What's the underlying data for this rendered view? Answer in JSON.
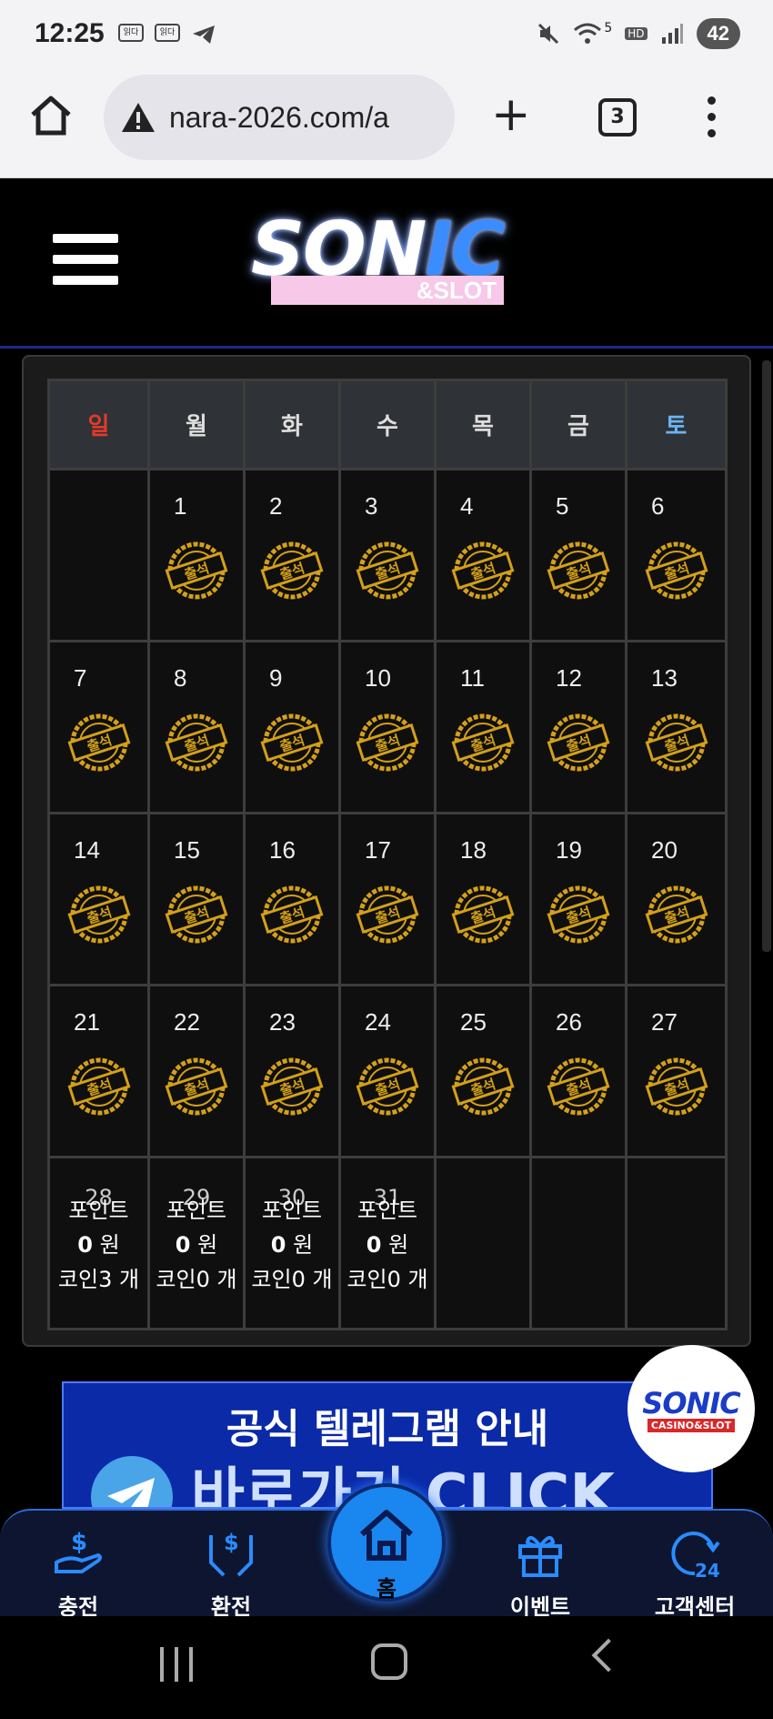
{
  "status_bar": {
    "time": "12:25",
    "battery": "42",
    "network": "5",
    "hd_label": "HD"
  },
  "browser": {
    "url": "nara-2026.com/a",
    "tab_count": "3"
  },
  "calendar": {
    "weekdays": [
      "일",
      "월",
      "화",
      "수",
      "목",
      "금",
      "토"
    ],
    "weeks": [
      [
        "",
        "1",
        "2",
        "3",
        "4",
        "5",
        "6"
      ],
      [
        "7",
        "8",
        "9",
        "10",
        "11",
        "12",
        "13"
      ],
      [
        "14",
        "15",
        "16",
        "17",
        "18",
        "19",
        "20"
      ],
      [
        "21",
        "22",
        "23",
        "24",
        "25",
        "26",
        "27"
      ]
    ],
    "stamp_label": "출석",
    "last_week": [
      {
        "day": "28",
        "point_label": "포인트",
        "points": "0",
        "won": "원",
        "coin_label": "코인3 개"
      },
      {
        "day": "29",
        "point_label": "포인트",
        "points": "0",
        "won": "원",
        "coin_label": "코인0 개"
      },
      {
        "day": "30",
        "point_label": "포인트",
        "points": "0",
        "won": "원",
        "coin_label": "코인0 개"
      },
      {
        "day": "31",
        "point_label": "포인트",
        "points": "0",
        "won": "원",
        "coin_label": "코인0 개"
      }
    ]
  },
  "banner": {
    "title": "공식 텔레그램 안내",
    "cta": "바로가기 CLICK"
  },
  "floating_logo": {
    "name": "SONIC",
    "sub": "CASINO&SLOT"
  },
  "logo": {
    "name_white": "SON",
    "name_blue": "IC",
    "sub": "&SLOT"
  },
  "bottom_nav": {
    "charge": "충전",
    "exchange": "환전",
    "home": "홈",
    "event": "이벤트",
    "support": "고객센터"
  },
  "colors": {
    "sunday": "#e23a2a",
    "saturday": "#6ab4f2",
    "stamp_gold": "#d4a017",
    "nav_blue": "#1a86f0"
  }
}
